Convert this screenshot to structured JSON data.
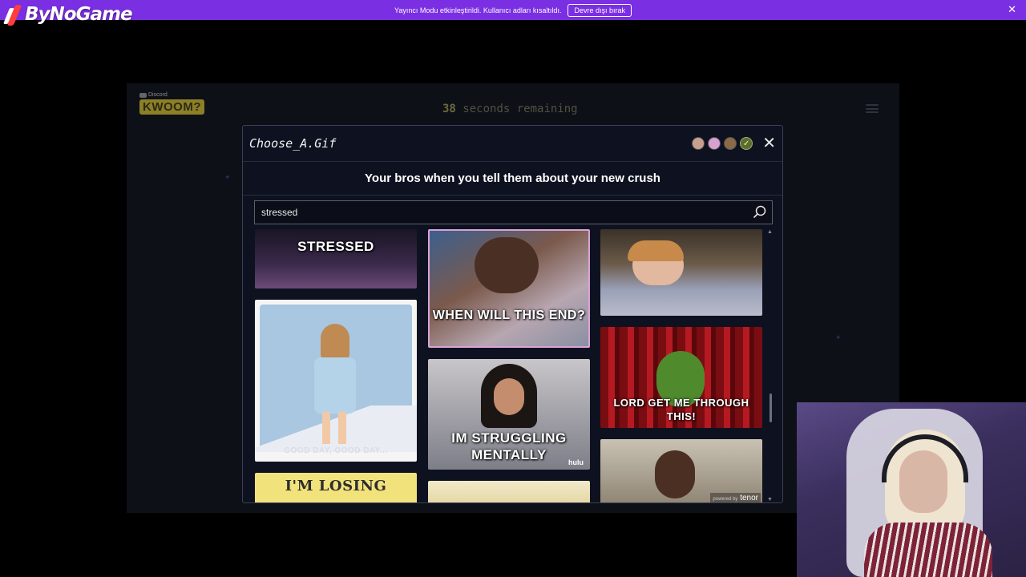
{
  "topbar": {
    "brand": "ByNoGame",
    "notice": "Yayıncı Modu etkinleştirildi. Kullanıcı adları kısaltıldı.",
    "notice_button": "Devre dışı bırak",
    "close": "✕"
  },
  "game": {
    "discord_label": "Discord",
    "logo": "KWOOM?",
    "timer_number": "38",
    "timer_text": "seconds remaining"
  },
  "modal": {
    "title": "Choose_A.Gif",
    "prompt": "Your bros when you tell them about your new crush",
    "close": "✕",
    "search": {
      "value": "stressed",
      "placeholder": ""
    },
    "tenor_prefix": "powered by",
    "tenor": "tenor",
    "gifs": [
      {
        "caption": "STRESSED"
      },
      {
        "caption": "GOOD DAY, GOOD DAY..."
      },
      {
        "caption": "I'M LOSING"
      },
      {
        "caption": "WHEN WILL THIS END?"
      },
      {
        "caption": "IM STRUGGLING MENTALLY"
      },
      {
        "caption": "hulu"
      },
      {
        "caption": ""
      },
      {
        "caption": "LORD GET ME THROUGH THIS!"
      },
      {
        "caption": ""
      }
    ]
  },
  "colors": {
    "accent": "#7b2fe3",
    "modal_bg": "#0e1220",
    "game_bg": "#0d1017"
  }
}
